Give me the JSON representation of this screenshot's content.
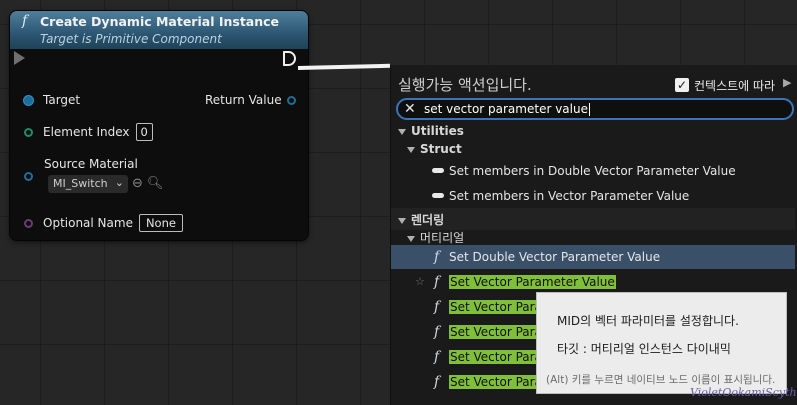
{
  "node": {
    "icon": "function-icon",
    "title": "Create Dynamic Material Instance",
    "subtitle": "Target is Primitive Component",
    "pins": {
      "target": "Target",
      "return_value": "Return Value",
      "element_index": "Element Index",
      "element_index_value": "0",
      "source_material": "Source Material",
      "source_material_value": "MI_Switch",
      "optional_name": "Optional Name",
      "optional_name_value": "None"
    },
    "colors": {
      "header": "#2c5673",
      "object_pin": "#1f6e99",
      "int_pin": "#1f8c6c",
      "name_pin": "#6a3c73"
    }
  },
  "menu": {
    "title": "실행가능 액션입니다.",
    "context_label": "컨텍스트에 따라",
    "context_checked": true,
    "search_value": "set vector parameter value",
    "categories": {
      "utilities": "Utilities",
      "struct": "Struct",
      "rendering": "렌더링",
      "material": "머티리얼"
    },
    "struct_items": [
      "Set members in Double Vector Parameter Value",
      "Set members in Vector Parameter Value"
    ],
    "material_items": [
      "Set Double Vector Parameter Value",
      "Set Vector Parameter Value",
      "Set Vector Para",
      "Set Vector Para",
      "Set Vector Para",
      "Set Vector Para"
    ],
    "highlight_color": "#7fbf3a",
    "selected_color": "#3a5069"
  },
  "tooltip": {
    "description": "MID의 벡터 파라미터를 설정합니다.",
    "target": "타깃 : 머티리얼 인스턴스 다이내믹",
    "hint": "(Alt) 키를 누르면 네이티브 노드 이름이 표시됩니다."
  },
  "watermark": "VioletOokamiScythe"
}
